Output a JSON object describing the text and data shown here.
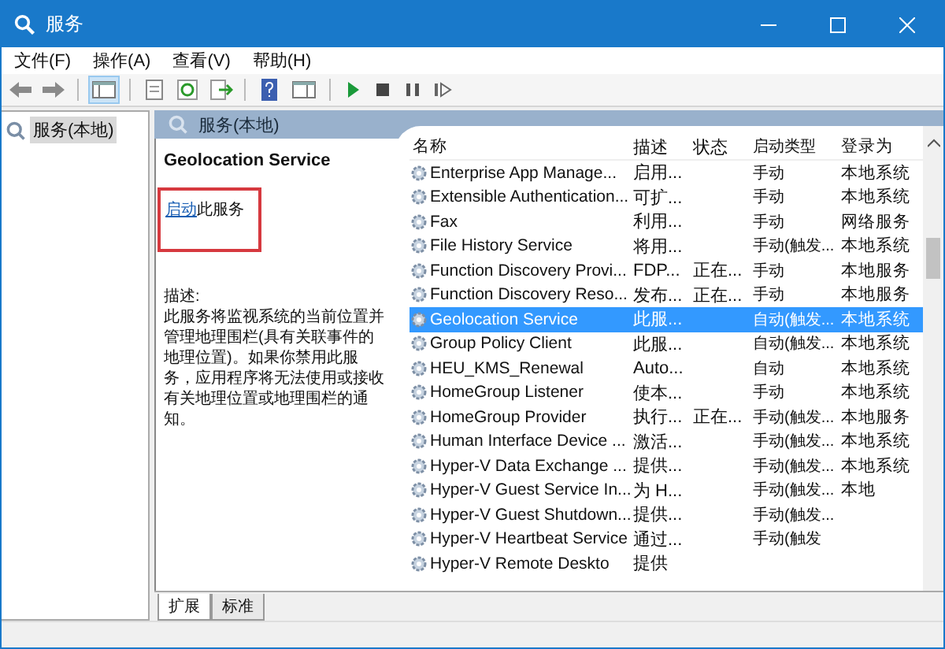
{
  "window": {
    "title": "服务"
  },
  "menu": [
    "文件(F)",
    "操作(A)",
    "查看(V)",
    "帮助(H)"
  ],
  "tree": [
    {
      "label": "服务(本地)",
      "selected": true
    }
  ],
  "pane_header": "服务(本地)",
  "details": {
    "title": "Geolocation Service",
    "action_link": "启动",
    "action_text": "此服务",
    "description_label": "描述:",
    "description": "此服务将监视系统的当前位置并管理地理围栏(具有关联事件的地理位置)。如果你禁用此服务，应用程序将无法使用或接收有关地理位置或地理围栏的通知。"
  },
  "table": {
    "columns": [
      "名称",
      "描述",
      "状态",
      "启动类型",
      "登录为"
    ],
    "rows": [
      {
        "name": "Enterprise App Manage...",
        "desc": "启用...",
        "status": "",
        "startup": "手动",
        "logon": "本地系统",
        "selected": false
      },
      {
        "name": "Extensible Authentication...",
        "desc": "可扩...",
        "status": "",
        "startup": "手动",
        "logon": "本地系统",
        "selected": false
      },
      {
        "name": "Fax",
        "desc": "利用...",
        "status": "",
        "startup": "手动",
        "logon": "网络服务",
        "selected": false
      },
      {
        "name": "File History Service",
        "desc": "将用...",
        "status": "",
        "startup": "手动(触发...",
        "logon": "本地系统",
        "selected": false
      },
      {
        "name": "Function Discovery Provi...",
        "desc": "FDP...",
        "status": "正在...",
        "startup": "手动",
        "logon": "本地服务",
        "selected": false
      },
      {
        "name": "Function Discovery Reso...",
        "desc": "发布...",
        "status": "正在...",
        "startup": "手动",
        "logon": "本地服务",
        "selected": false
      },
      {
        "name": "Geolocation Service",
        "desc": "此服...",
        "status": "",
        "startup": "自动(触发...",
        "logon": "本地系统",
        "selected": true
      },
      {
        "name": "Group Policy Client",
        "desc": "此服...",
        "status": "",
        "startup": "自动(触发...",
        "logon": "本地系统",
        "selected": false
      },
      {
        "name": "HEU_KMS_Renewal",
        "desc": "Auto...",
        "status": "",
        "startup": "自动",
        "logon": "本地系统",
        "selected": false
      },
      {
        "name": "HomeGroup Listener",
        "desc": "使本...",
        "status": "",
        "startup": "手动",
        "logon": "本地系统",
        "selected": false
      },
      {
        "name": "HomeGroup Provider",
        "desc": "执行...",
        "status": "正在...",
        "startup": "手动(触发...",
        "logon": "本地服务",
        "selected": false
      },
      {
        "name": "Human Interface Device ...",
        "desc": "激活...",
        "status": "",
        "startup": "手动(触发...",
        "logon": "本地系统",
        "selected": false
      },
      {
        "name": "Hyper-V Data Exchange ...",
        "desc": "提供...",
        "status": "",
        "startup": "手动(触发...",
        "logon": "本地系统",
        "selected": false
      },
      {
        "name": "Hyper-V Guest Service In...",
        "desc": "为 H...",
        "status": "",
        "startup": "手动(触发...",
        "logon": "本地",
        "selected": false
      },
      {
        "name": "Hyper-V Guest Shutdown...",
        "desc": "提供...",
        "status": "",
        "startup": "手动(触发...",
        "logon": "",
        "selected": false
      },
      {
        "name": "Hyper-V Heartbeat Service",
        "desc": "通过...",
        "status": "",
        "startup": "手动(触发",
        "logon": "",
        "selected": false
      },
      {
        "name": "Hyper-V Remote Deskto",
        "desc": "提供",
        "status": "",
        "startup": "",
        "logon": "",
        "selected": false
      }
    ]
  },
  "bottom_tabs": [
    {
      "label": "扩展",
      "selected": true
    },
    {
      "label": "标准",
      "selected": false
    }
  ]
}
